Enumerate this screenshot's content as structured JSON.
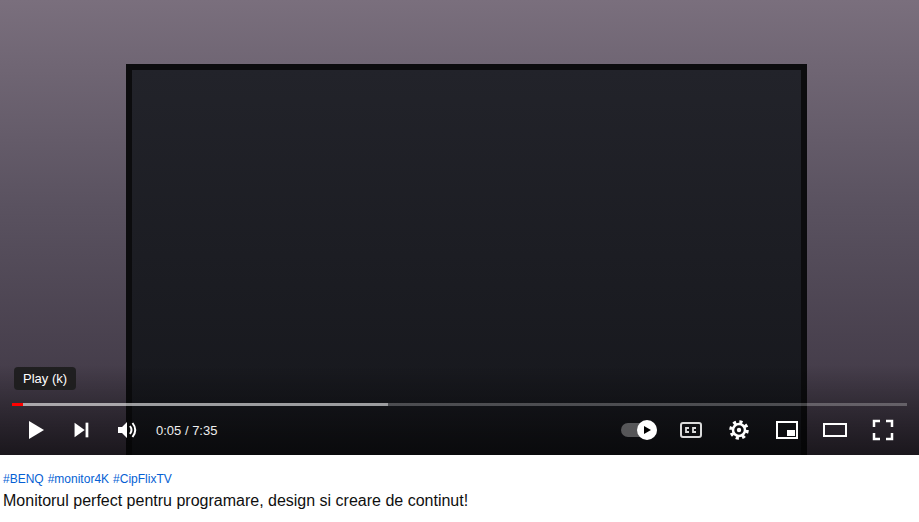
{
  "player": {
    "tooltip": "Play (k)",
    "time": "0:05 / 7:35",
    "playing": false,
    "autoplay": true,
    "captions": false,
    "progress": {
      "played": 0.012,
      "buffered": 0.42
    }
  },
  "video": {
    "hashtags": [
      "#BENQ",
      "#monitor4K",
      "#CipFlixTV"
    ],
    "title": "Monitorul perfect pentru programare, design si creare de continut!"
  }
}
